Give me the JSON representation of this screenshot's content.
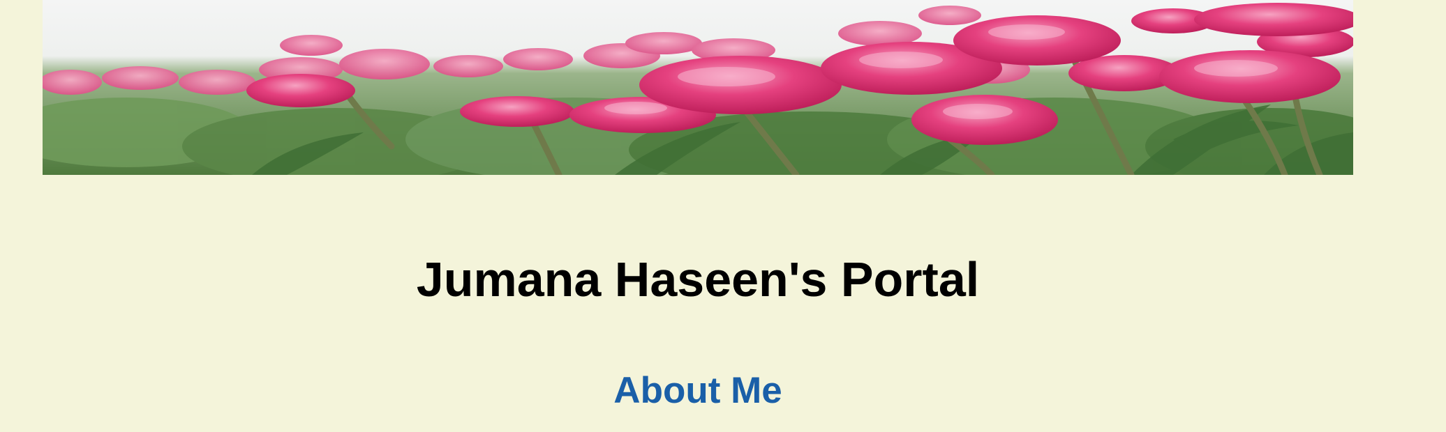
{
  "banner": {
    "alt": "Pink tulips field",
    "colors": {
      "sky": "#f7f8f8",
      "petal": "#e73a7c",
      "petal_dark": "#c51e5d",
      "petal_light": "#f6a0bf",
      "leaf": "#5f8c4a",
      "leaf_dark": "#3c6a32"
    }
  },
  "header": {
    "title": "Jumana Haseen's Portal"
  },
  "nav": {
    "about_label": "About Me",
    "link_color": "#1a5fa8"
  }
}
